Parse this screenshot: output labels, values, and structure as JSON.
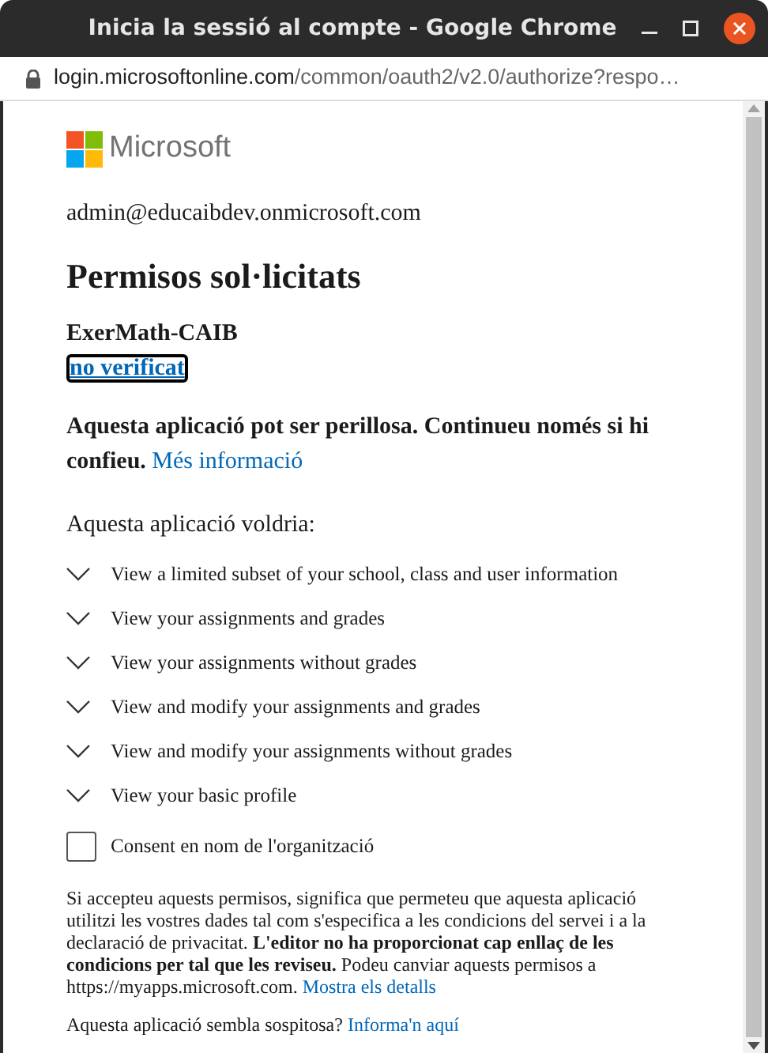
{
  "window": {
    "title": "Inicia la sessió al compte - Google Chrome"
  },
  "address_bar": {
    "host": "login.microsoftonline.com",
    "path": "/common/oauth2/v2.0/authorize?respo…"
  },
  "page": {
    "brand": "Microsoft",
    "account": "admin@educaibdev.onmicrosoft.com",
    "heading": "Permisos sol·licitats",
    "app_name": "ExerMath-CAIB",
    "verification_link": "no verificat",
    "warning": {
      "text": "Aquesta aplicació pot ser perillosa. Continueu només si hi confieu.",
      "link": "Més informació"
    },
    "permissions_label": "Aquesta aplicació voldria:",
    "permissions": [
      {
        "label": "View a limited subset of your school, class and user information",
        "expanded": false
      },
      {
        "label": "View your assignments and grades",
        "expanded": false
      },
      {
        "label": "View your assignments without grades",
        "expanded": false
      },
      {
        "label": "View and modify your assignments and grades",
        "expanded": false
      },
      {
        "label": "View and modify your assignments without grades",
        "expanded": false
      },
      {
        "label": "View your basic profile",
        "expanded": false
      }
    ],
    "consent": {
      "label": "Consent en nom de l'organització",
      "checked": false
    },
    "notice": {
      "text": "Si accepteu aquests permisos, significa que permeteu que aquesta aplicació utilitzi les vostres dades tal com s'especifica a les condicions del servei i a la declaració de privacitat. **L'editor no ha proporcionat cap enllaç de les condicions per tal que les reviseu.** Podeu canviar aquests permisos a https://myapps.microsoft.com.",
      "link": "Mostra els detalls"
    },
    "report": {
      "text": "Aquesta aplicació sembla sospitosa?",
      "link": "Informa'n aquí"
    }
  }
}
